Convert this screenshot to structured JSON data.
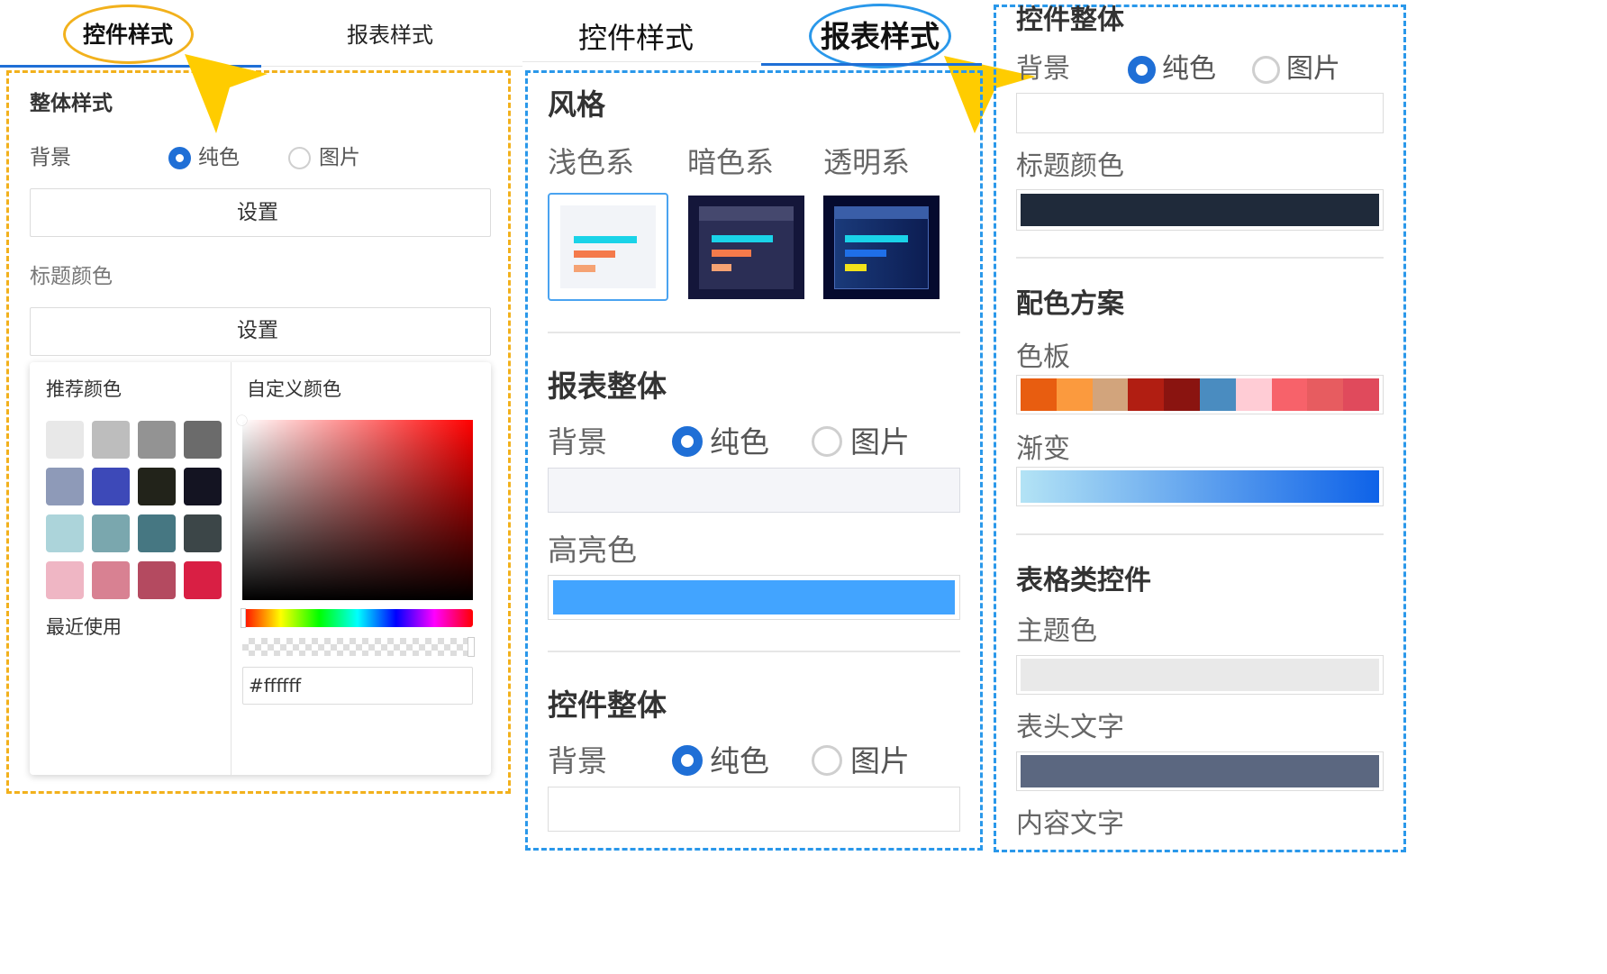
{
  "panel1": {
    "tabs": [
      "控件样式",
      "报表样式"
    ],
    "section_title": "整体样式",
    "background_label": "背景",
    "radio_solid": "纯色",
    "radio_image": "图片",
    "set_button": "设置",
    "title_color_label": "标题颜色",
    "title_set_button": "设置",
    "picker": {
      "recommended_label": "推荐颜色",
      "custom_label": "自定义颜色",
      "recent_label": "最近使用",
      "hex_value": "#ffffff",
      "swatches": [
        "#e8e8e8",
        "#bdbdbd",
        "#939393",
        "#6b6b6b",
        "#8e9ab8",
        "#3d49b8",
        "#22231a",
        "#141422",
        "#acd4da",
        "#7aa7ae",
        "#467782",
        "#3c4648",
        "#efb6c4",
        "#d88192",
        "#b44a60",
        "#d91f44"
      ]
    }
  },
  "panel2": {
    "tabs": [
      "控件样式",
      "报表样式"
    ],
    "style_title": "风格",
    "themes": [
      "浅色系",
      "暗色系",
      "透明系"
    ],
    "report_title": "报表整体",
    "background_label": "背景",
    "radio_solid": "纯色",
    "radio_image": "图片",
    "highlight_label": "高亮色",
    "highlight_color": "#42a4ff",
    "widget_title": "控件整体",
    "widget_background_label": "背景",
    "widget_radio_solid": "纯色",
    "widget_radio_image": "图片"
  },
  "panel3": {
    "widget_title": "控件整体",
    "background_label": "背景",
    "radio_solid": "纯色",
    "radio_image": "图片",
    "title_color_label": "标题颜色",
    "title_color": "#1f2a3a",
    "scheme_title": "配色方案",
    "palette_label": "色板",
    "palette": [
      "#e85d10",
      "#fb9a3e",
      "#d2a47c",
      "#b11e12",
      "#8a1410",
      "#4a8cc0",
      "#ffccd5",
      "#f7626a",
      "#e75c60",
      "#e04a5c"
    ],
    "gradient_label": "渐变",
    "table_title": "表格类控件",
    "theme_color_label": "主题色",
    "header_text_label": "表头文字",
    "header_text_color": "#5b6780",
    "content_text_label": "内容文字"
  },
  "colors": {
    "orange": "#f2b11c",
    "blue": "#2a98ea",
    "accent": "#1f6fd6"
  }
}
